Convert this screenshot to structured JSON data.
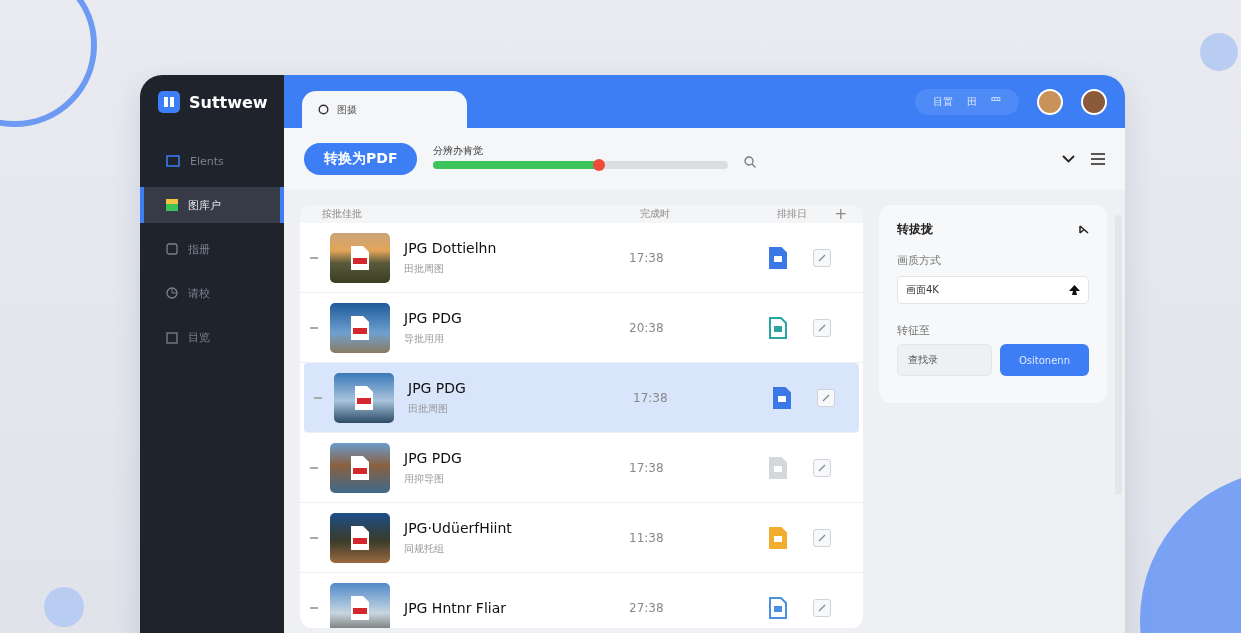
{
  "app": {
    "logo": "Suttwew"
  },
  "sidebar": {
    "items": [
      {
        "label": "Elents",
        "selected": false
      },
      {
        "label": "图库户",
        "selected": true
      },
      {
        "label": "指册",
        "selected": false
      },
      {
        "label": "请校",
        "selected": false
      },
      {
        "label": "目览",
        "selected": false
      }
    ]
  },
  "tab": {
    "label": "图摄"
  },
  "header": {
    "pills": [
      "目置",
      "田",
      "罒"
    ]
  },
  "toolbar": {
    "convert_button": "转换为PDF",
    "progress_label": "分辨办肯觉",
    "progress": {
      "level": 0.56
    }
  },
  "list": {
    "columns": [
      "按批佳批",
      "完成时",
      "排排日"
    ],
    "add": "+",
    "rows": [
      {
        "name": "JPG Dottielhn",
        "sub": "田批周图",
        "time": "17:38",
        "kind": "filled",
        "color": "#3b78e7",
        "checked": false,
        "selected": false
      },
      {
        "name": "JPG PDG",
        "sub": "导批用用",
        "time": "20:38",
        "kind": "outline",
        "color": "#2aa6a0",
        "checked": false,
        "selected": false
      },
      {
        "name": "JPG PDG",
        "sub": "田批周图",
        "time": "17:38",
        "kind": "filled",
        "color": "#3b78e7",
        "checked": false,
        "selected": true
      },
      {
        "name": "JPG PDG",
        "sub": "用抑导图",
        "time": "17:38",
        "kind": "filled",
        "color": "#d4d7dc",
        "checked": false,
        "selected": false
      },
      {
        "name": "JPG·UdüerfHiint",
        "sub": "同规托组",
        "time": "11:38",
        "kind": "filled",
        "color": "#f2ad2c",
        "checked": false,
        "selected": false
      },
      {
        "name": "JPG Hntnr Fliar",
        "time": "27:38",
        "kind": "outline",
        "color": "#4a8fe0",
        "checked": false,
        "selected": false
      }
    ]
  },
  "panel": {
    "title": "转拔拢",
    "quality_label": "画质方式",
    "quality_value": "画面4K",
    "target_label": "转征至",
    "target_value": "查找录",
    "action_button": "Ositonenn"
  }
}
